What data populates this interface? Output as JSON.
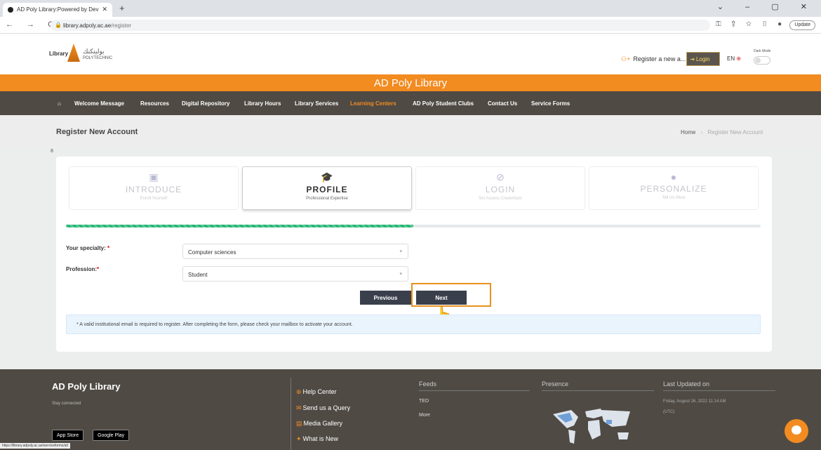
{
  "browser": {
    "tab_title": "AD Poly Library:Powered by Dev",
    "tab_close": "✕",
    "new_tab": "+",
    "window_controls": "⌄ – ▢ ✕",
    "nav_buttons": "← → C",
    "url_host": "library.adpoly.ac.ae",
    "url_path": "/register",
    "tool_icons": "⚿ ⇪ ☆ ▯ ●",
    "update_label": "Update"
  },
  "header": {
    "logo_library": "Library",
    "logo_arabic": "بوليتكنك",
    "logo_poly": "POLYTECHNIC",
    "register_label": "Register a new a...",
    "login_label": "Login",
    "lang_label": "EN",
    "dark_mode_label": "Dark Mode"
  },
  "banner": {
    "title": "AD Poly Library"
  },
  "menu": {
    "items": [
      "Welcome Message",
      "Resources",
      "Digital Repository",
      "Library Hours",
      "Library Services",
      "Learning Centers",
      "AD Poly Student Clubs",
      "Contact Us",
      "Service Forms"
    ],
    "active": "Learning Centers"
  },
  "page": {
    "title": "Register New Account",
    "breadcrumb_home": "Home",
    "breadcrumb_sep": "›",
    "breadcrumb_current": "Register New Account",
    "stray_number": "8"
  },
  "steps": [
    {
      "name": "INTRODUCE",
      "sub": "Enroll Yourself",
      "active": false
    },
    {
      "name": "PROFILE",
      "sub": "Professional Expertise",
      "active": true
    },
    {
      "name": "LOGIN",
      "sub": "Set Access Credentials",
      "active": false
    },
    {
      "name": "PERSONALIZE",
      "sub": "Tell Us More",
      "active": false
    }
  ],
  "progress": {
    "fraction": 0.5
  },
  "form": {
    "specialty_label": "Your specialty:",
    "specialty_value": "Computer sciences",
    "profession_label": "Profession:",
    "profession_value": "Student",
    "required_mark": "*",
    "previous_label": "Previous",
    "next_label": "Next",
    "note": "* A valid institutional email is required to register. After completing the form, please check your mailbox to activate your account."
  },
  "footer": {
    "title": "AD Poly Library",
    "stay_connected": "Stay connected",
    "app_store": "App Store",
    "google_play": "Google Play",
    "links": [
      "Help Center",
      "Send us a Query",
      "Media Gallery",
      "What is New"
    ],
    "feeds_heading": "Feeds",
    "feeds_items": [
      "TED",
      "More"
    ],
    "presence_heading": "Presence",
    "updated_heading": "Last Updated on",
    "updated_value": "Friday, August 26, 2022 11:14 AM",
    "updated_tz": "(UTC)"
  },
  "status_bar": "https://library.adpoly.ac.ae/serviceforms/all",
  "colors": {
    "accent": "#f28b20",
    "nav_bg": "#4f4a44",
    "progress": "#22b573",
    "button": "#3a3f4c",
    "highlight": "#e8911f"
  }
}
